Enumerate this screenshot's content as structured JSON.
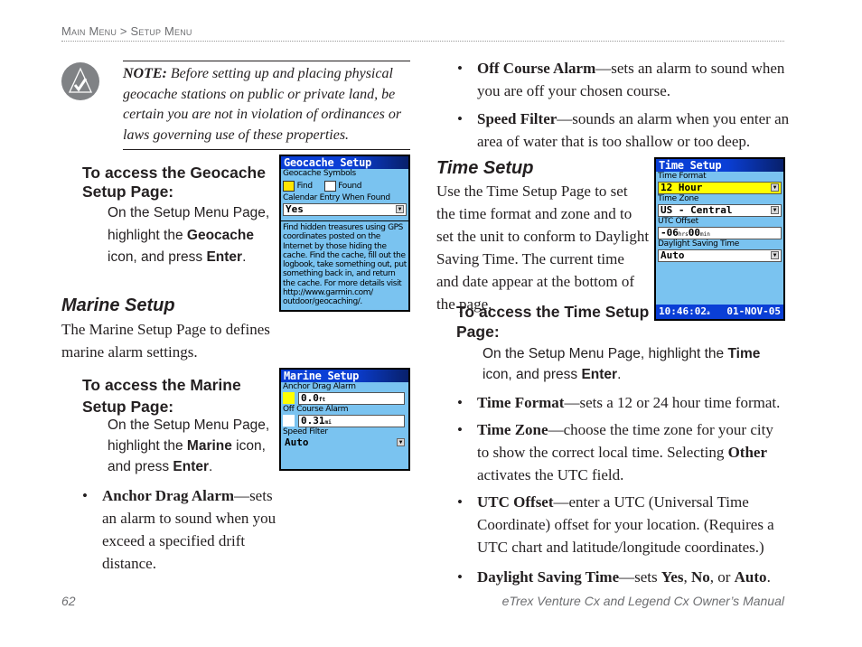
{
  "header": {
    "breadcrumb": [
      "Main Menu",
      "Setup Menu"
    ],
    "separator": ">"
  },
  "note": {
    "icon": "note-check-icon",
    "label": "NOTE:",
    "text": "Before setting up and placing physical geocache stations on public or private land, be certain you are not in violation of ordinances or laws governing use of these properties."
  },
  "geocache_access": {
    "heading_line1": "To access the Geocache",
    "heading_line2": "Setup Page:",
    "step_pre": "On the Setup Menu Page, highlight the ",
    "step_bold1": "Geocache",
    "step_mid": " icon, and press ",
    "step_bold2": "Enter",
    "step_end": "."
  },
  "marine": {
    "heading": "Marine Setup",
    "intro": "The Marine Setup Page to defines marine alarm settings.",
    "access_heading_line1": "To access the Marine",
    "access_heading_line2": "Setup Page:",
    "step_pre": "On the Setup Menu Page, highlight the ",
    "step_bold1": "Marine",
    "step_mid": " icon, and press ",
    "step_bold2": "Enter",
    "step_end": ".",
    "bullets": [
      {
        "term": "Anchor Drag Alarm",
        "text": "—sets an alarm to sound when you exceed a specified drift distance."
      },
      {
        "term": "Off Course Alarm",
        "text": "—sets an alarm to sound when you are off your chosen course."
      },
      {
        "term": "Speed Filter",
        "text": "—sounds an alarm when you enter an area of water that is too shallow or too deep."
      }
    ]
  },
  "time": {
    "heading": "Time Setup",
    "intro": "Use the Time Setup Page to set the time format and zone and to set the unit to conform to Daylight Saving Time. The current time and date appear at the bottom of the page.",
    "access_heading_line1": "To access the Time Setup",
    "access_heading_line2": "Page:",
    "step_pre": "On the Setup Menu Page, highlight the ",
    "step_bold1": "Time",
    "step_mid": " icon, and press ",
    "step_bold2": "Enter",
    "step_end": ".",
    "bullets": [
      {
        "term": "Time Format",
        "text": "—sets a 12 or 24 hour time format."
      },
      {
        "term": "Time Zone",
        "text": "—choose the time zone for your city to show the correct local time. Selecting ",
        "term2": "Other",
        "text2": " activates the UTC field."
      },
      {
        "term": "UTC Offset",
        "text": "—enter  a UTC (Universal Time Coordinate) offset for your location. (Requires a UTC chart and latitude/longitude coordinates.)"
      },
      {
        "term": "Daylight Saving Time",
        "text": "—sets ",
        "opt1": "Yes",
        "sep1": ", ",
        "opt2": "No",
        "sep2": ", or ",
        "opt3": "Auto",
        "end": "."
      }
    ]
  },
  "screens": {
    "geocache": {
      "title": "Geocache Setup",
      "symbols_label": "Geocache Symbols",
      "find_label": "Find",
      "found_label": "Found",
      "calendar_label": "Calendar Entry When Found",
      "calendar_value": "Yes",
      "description": "Find hidden treasures using GPS coordinates posted on the Internet by those hiding the cache. Find the cache, fill out the logbook, take something out, put something back in, and return the cache. For more details visit http://www.garmin.com/ outdoor/geocaching/."
    },
    "marine": {
      "title": "Marine Setup",
      "anchor_label": "Anchor Drag Alarm",
      "anchor_value": "0.0",
      "anchor_unit": "ft",
      "offcourse_label": "Off Course Alarm",
      "offcourse_value": "0.31",
      "offcourse_unit": "mi",
      "speed_label": "Speed Filter",
      "speed_value": "Auto"
    },
    "time": {
      "title": "Time Setup",
      "format_label": "Time Format",
      "format_value": "12 Hour",
      "zone_label": "Time Zone",
      "zone_value": "US - Central",
      "utc_label": "UTC Offset",
      "utc_hours": "-06",
      "utc_hours_unit": "hrs",
      "utc_minutes": "00",
      "utc_minutes_unit": "min",
      "dst_label": "Daylight Saving Time",
      "dst_value": "Auto",
      "current_time": "10:46:02",
      "current_time_suffix": "a",
      "current_date": "01-NOV-05"
    }
  },
  "footer": {
    "page_number": "62",
    "manual_title": "eTrex Venture Cx and Legend Cx Owner’s Manual"
  },
  "colors": {
    "screen_bg": "#7ac3f0",
    "screen_title": "#0a3fd6",
    "highlight": "#ffff00",
    "text": "#231f20",
    "muted": "#6d6e71"
  }
}
